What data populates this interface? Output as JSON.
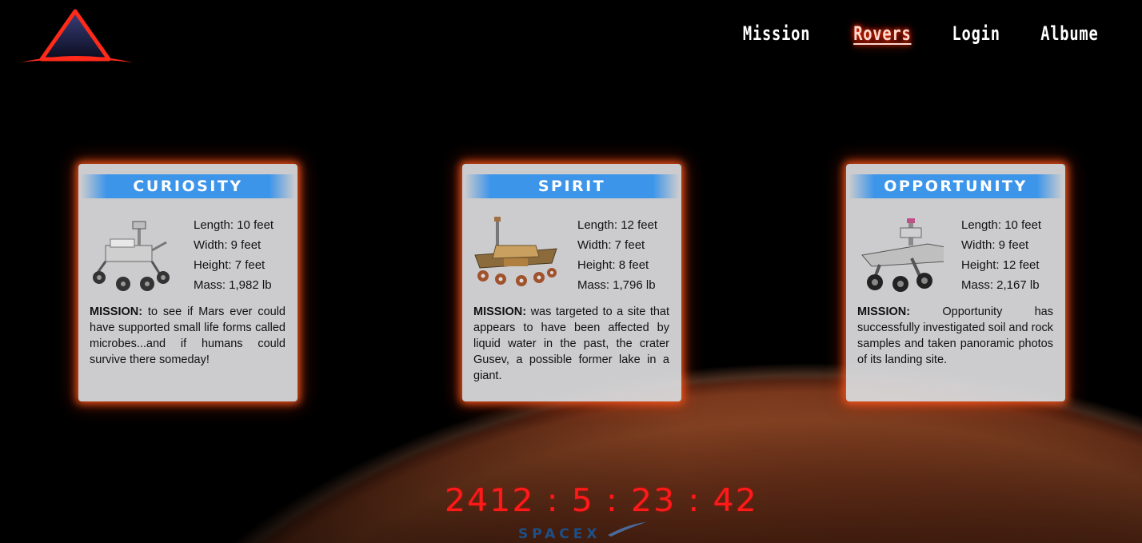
{
  "nav": {
    "items": [
      {
        "label": "Mission",
        "active": false
      },
      {
        "label": "Rovers",
        "active": true
      },
      {
        "label": "Login",
        "active": false
      },
      {
        "label": "Albume",
        "active": false
      }
    ]
  },
  "rovers": [
    {
      "name": "CURIOSITY",
      "specs": [
        "Length: 10 feet",
        "Width: 9 feet",
        "Height: 7 feet",
        "Mass: 1,982 lb"
      ],
      "mission_label": "MISSION:",
      "mission_text": "to see if Mars ever could have supported small life forms called microbes...and if humans could survive there someday!"
    },
    {
      "name": "SPIRIT",
      "specs": [
        "Length: 12 feet",
        "Width: 7 feet",
        "Height: 8 feet",
        "Mass: 1,796 lb"
      ],
      "mission_label": "MISSION:",
      "mission_text": "was targeted to a site that appears to have been affected by liquid water in the past, the crater Gusev, a possible former lake in a giant."
    },
    {
      "name": "OPPORTUNITY",
      "specs": [
        "Length: 10 feet",
        "Width: 9 feet",
        "Height: 12 feet",
        "Mass: 2,167 lb"
      ],
      "mission_label": "MISSION:",
      "mission_text": "Opportunity has successfully investigated soil and rock samples and taken panoramic photos of its landing site."
    }
  ],
  "countdown": "2412 : 5 : 23 : 42",
  "footer_logo_text": "SPACEX",
  "colors": {
    "accent_red": "#ff1a1a",
    "card_header_blue": "#3d95ea",
    "card_glow": "#ff5a1e"
  },
  "icons": [
    "triangle-logo-icon",
    "curiosity-rover-image",
    "spirit-rover-image",
    "opportunity-rover-image",
    "spacex-logo"
  ]
}
